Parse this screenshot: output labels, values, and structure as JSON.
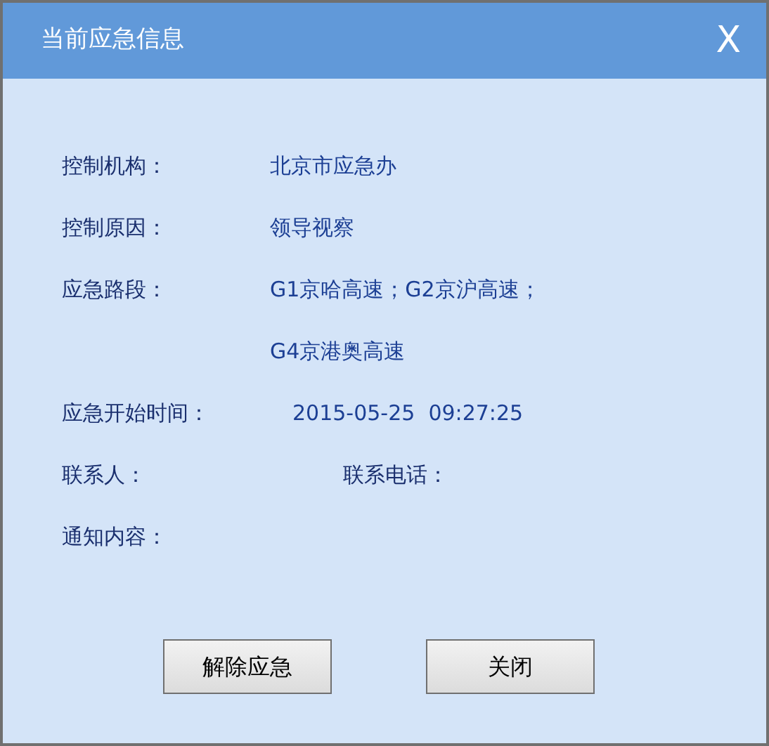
{
  "window": {
    "title": "当前应急信息",
    "close": "X"
  },
  "fields": [
    {
      "kind": "text",
      "label": "控制机构：",
      "lines": [
        "北京市应急办"
      ]
    },
    {
      "kind": "text",
      "label": "控制原因：",
      "lines": [
        "领导视察"
      ]
    },
    {
      "kind": "text",
      "label": "应急路段：",
      "lines": [
        "G1京哈高速；G2京沪高速；",
        "G4京港奥高速"
      ]
    },
    {
      "kind": "time",
      "label": "应急开始时间：",
      "lines": [
        "2015-05-25  09:27:25"
      ]
    },
    {
      "kind": "pair",
      "label": "联系人：",
      "second_label": "联系电话："
    },
    {
      "kind": "text",
      "label": "通知内容："
    }
  ],
  "buttons": [
    "解除应急",
    "关闭"
  ]
}
